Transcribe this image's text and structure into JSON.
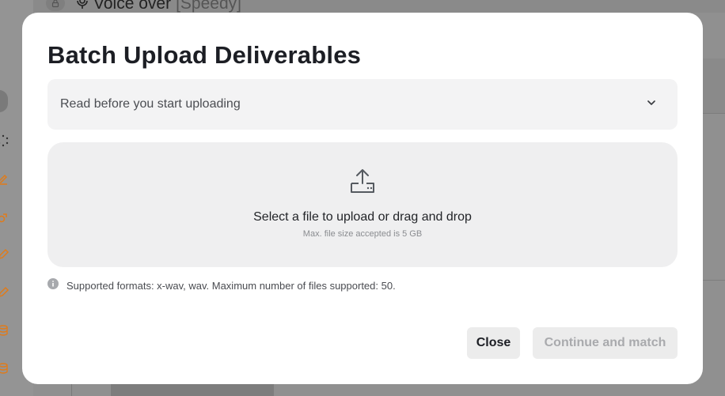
{
  "background": {
    "title": "Voice over",
    "title_tag": "[Speedy]"
  },
  "modal": {
    "title": "Batch Upload Deliverables",
    "accordion_label": "Read before you start uploading",
    "dropzone": {
      "main_text": "Select a file to upload or drag and drop",
      "sub_text": "Max. file size accepted is 5 GB"
    },
    "info_text": "Supported formats: x-wav, wav. Maximum number of files supported: 50.",
    "buttons": {
      "close": "Close",
      "continue": "Continue and match"
    }
  },
  "colors": {
    "accent_orange": "#e07b1a",
    "overlay_gray": "#8f8f8f",
    "modal_bg": "#ffffff",
    "panel_bg": "#f3f3f4"
  },
  "icons": [
    "lock-icon",
    "microphone-icon",
    "chevron-down-icon",
    "upload-tray-icon",
    "info-icon",
    "spinner-icon",
    "pencil-icon",
    "coins-icon"
  ]
}
